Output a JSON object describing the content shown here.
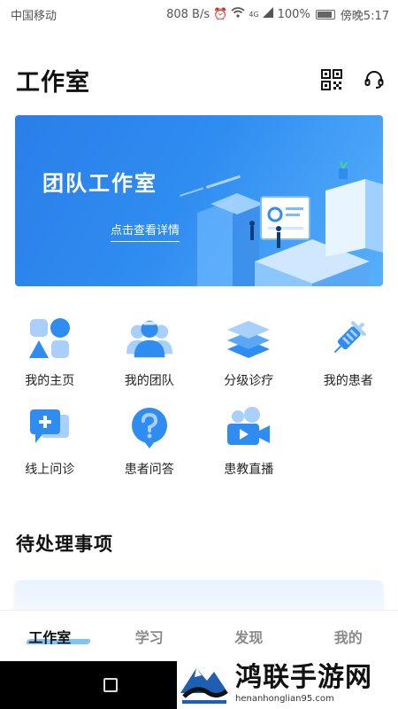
{
  "status_bar": {
    "carrier": "中国移动",
    "speed": "808 B/s",
    "network": "4G",
    "battery": "100%",
    "time": "傍晚5:17"
  },
  "header": {
    "title": "工作室",
    "qr_icon": "qr-code-icon",
    "service_icon": "headset-icon"
  },
  "banner": {
    "title": "团队工作室",
    "link_text": "点击查看详情"
  },
  "grid": {
    "items": [
      {
        "label": "我的主页",
        "icon": "home-blocks-icon"
      },
      {
        "label": "我的团队",
        "icon": "team-icon"
      },
      {
        "label": "分级诊疗",
        "icon": "layers-icon"
      },
      {
        "label": "我的患者",
        "icon": "syringe-icon"
      },
      {
        "label": "线上问诊",
        "icon": "chat-plus-icon"
      },
      {
        "label": "患者问答",
        "icon": "question-icon"
      },
      {
        "label": "患教直播",
        "icon": "video-camera-icon"
      }
    ]
  },
  "pending": {
    "title": "待处理事项"
  },
  "tabs": [
    {
      "label": "工作室",
      "active": true
    },
    {
      "label": "学习",
      "active": false
    },
    {
      "label": "发现",
      "active": false
    },
    {
      "label": "我的",
      "active": false
    }
  ],
  "watermark": {
    "title": "鸿联手游网",
    "url": "henanhonglian95.com"
  },
  "colors": {
    "accent": "#2f8cf0",
    "tab_underline": "#7ec3f5"
  }
}
